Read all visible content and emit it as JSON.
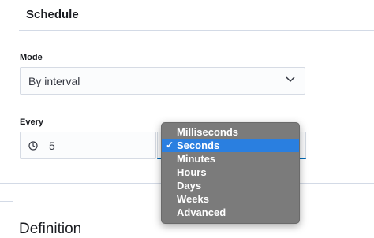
{
  "header": {
    "title": "Schedule"
  },
  "mode": {
    "label": "Mode",
    "value": "By interval"
  },
  "every": {
    "label": "Every",
    "value": "5",
    "unit_options": [
      {
        "label": "Milliseconds",
        "selected": false
      },
      {
        "label": "Seconds",
        "selected": true
      },
      {
        "label": "Minutes",
        "selected": false
      },
      {
        "label": "Hours",
        "selected": false
      },
      {
        "label": "Days",
        "selected": false
      },
      {
        "label": "Weeks",
        "selected": false
      },
      {
        "label": "Advanced",
        "selected": false
      }
    ],
    "check_mark": "✓"
  },
  "definition": {
    "title": "Definition"
  },
  "colors": {
    "accent": "#006bb8",
    "selected_option": "#2a7fe0",
    "menu_background": "#7b7b7b"
  },
  "icons": {
    "mode_chevron": "chevron-down-icon",
    "every_prefix": "clock-icon"
  }
}
